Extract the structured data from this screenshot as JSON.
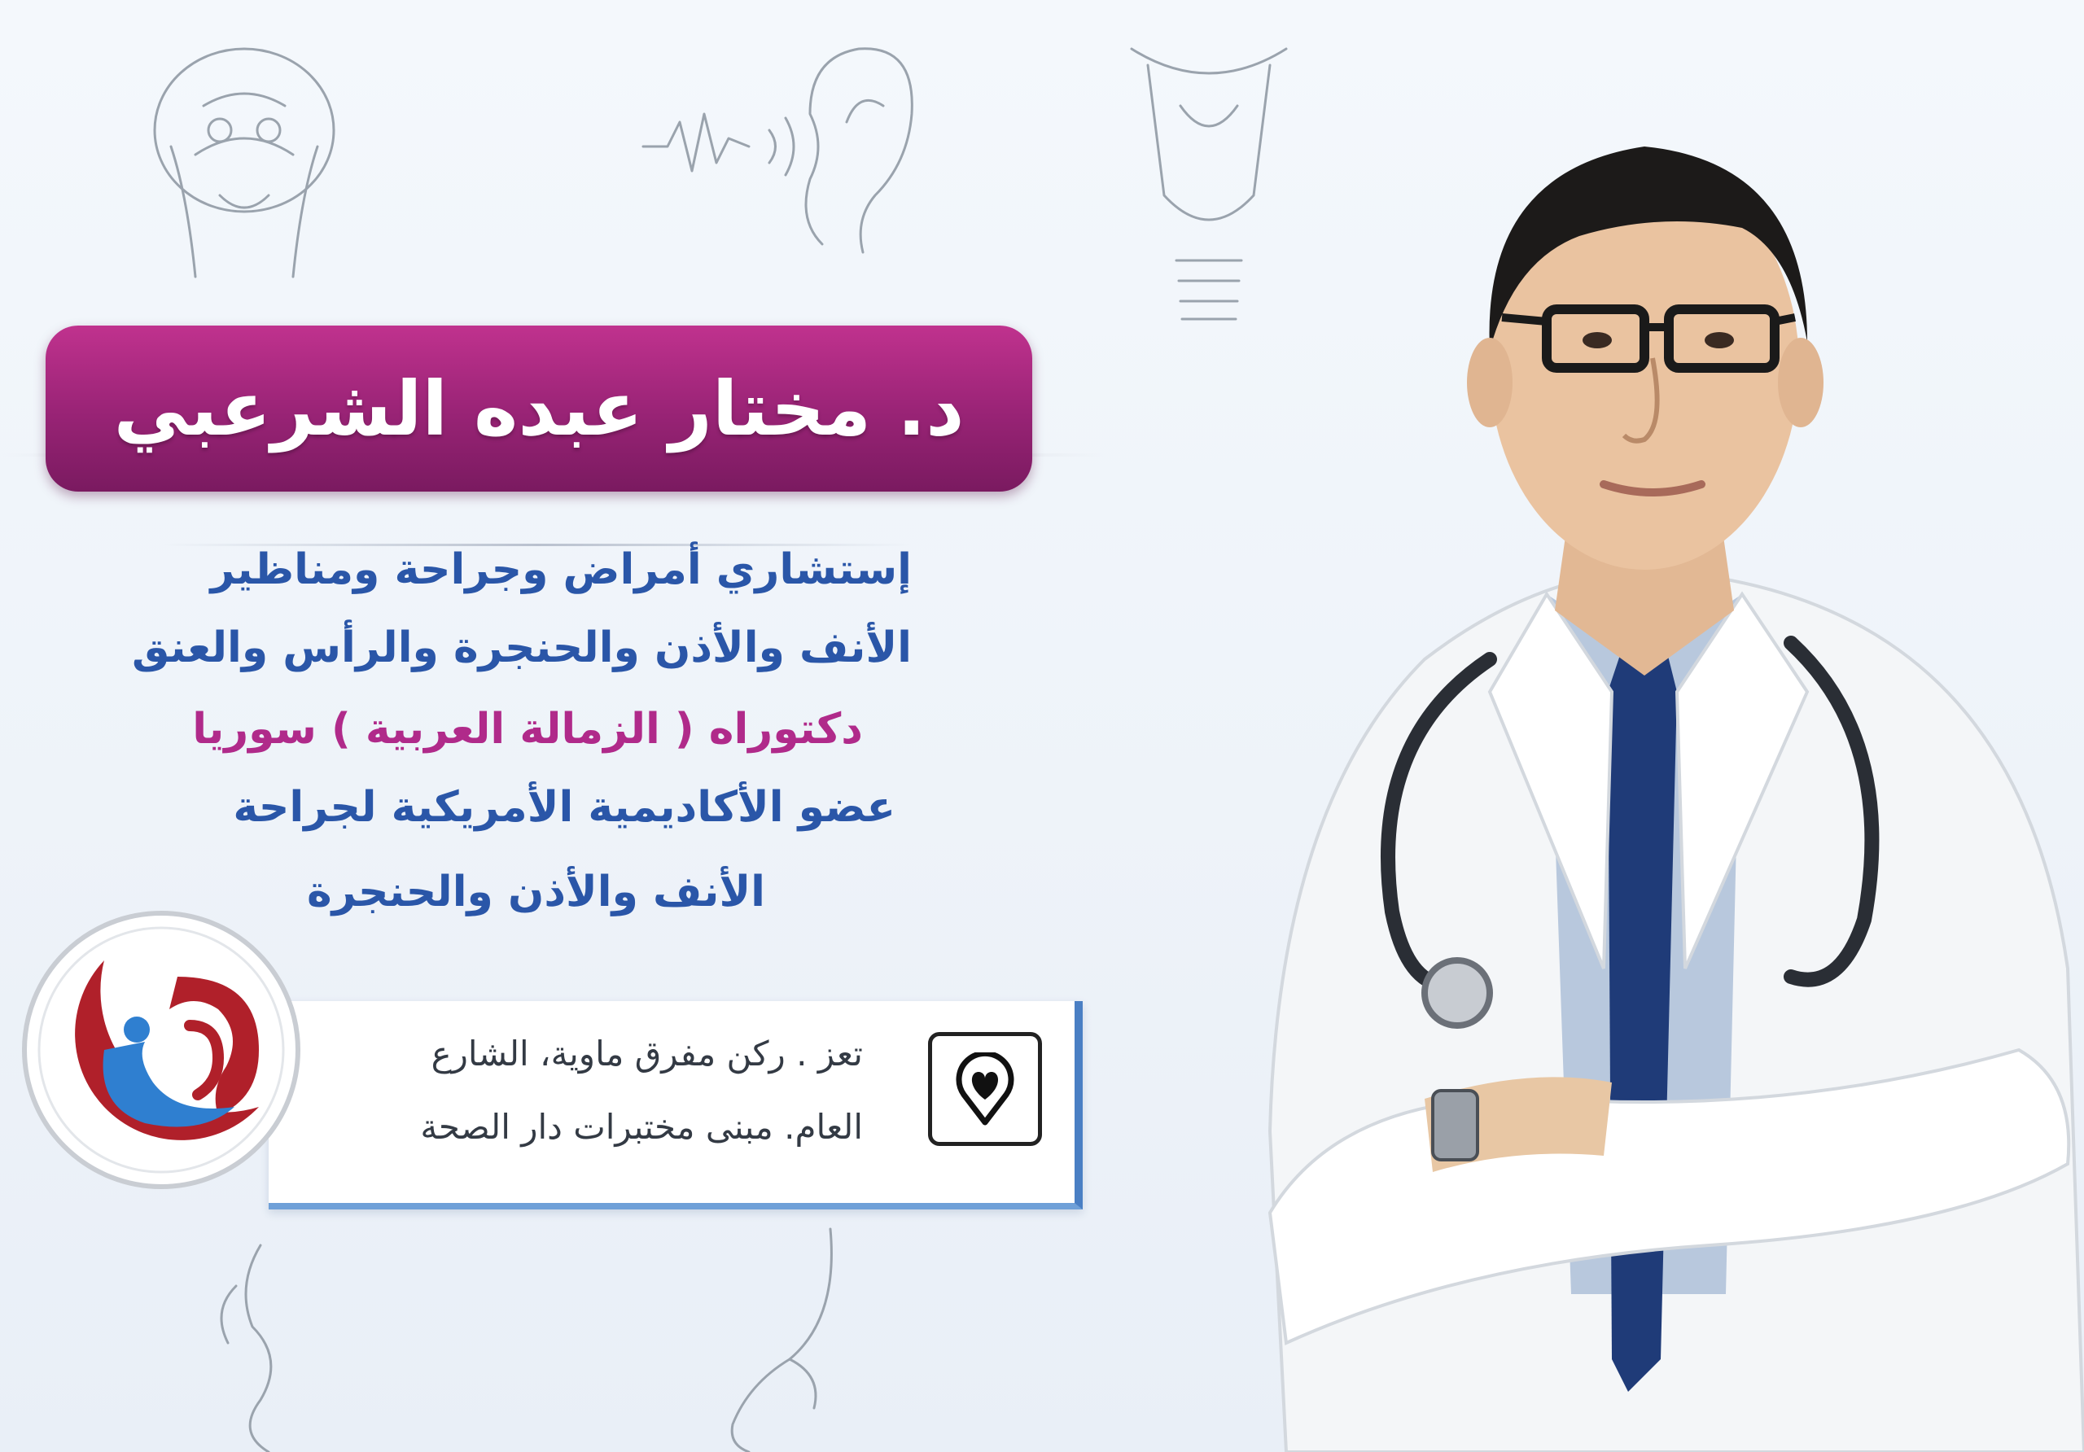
{
  "doctor_name": "د. مختار عبده الشرعبي",
  "credentials": [
    "إستشاري أمراض وجراحة ومناظير",
    "الأنف والأذن والحنجرة والرأس والعنق",
    "دكتوراه ( الزمالة العربية ) سوريا",
    "عضو الأكاديمية الأمريكية لجراحة",
    "الأنف والأذن والحنجرة"
  ],
  "address": {
    "line1": "تعز . ركن مفرق ماوية، الشارع",
    "line2": "العام. مبنى مختبرات دار الصحة"
  },
  "icons": {
    "location": "map-pin-icon",
    "brand": "clinic-logo"
  },
  "colors": {
    "banner": "#9b2477",
    "blue_text": "#2a56a8",
    "pink_text": "#b02a8a",
    "card_accent": "#4a7fc4",
    "logo_red": "#b0202a",
    "logo_blue": "#2f7fd0"
  }
}
